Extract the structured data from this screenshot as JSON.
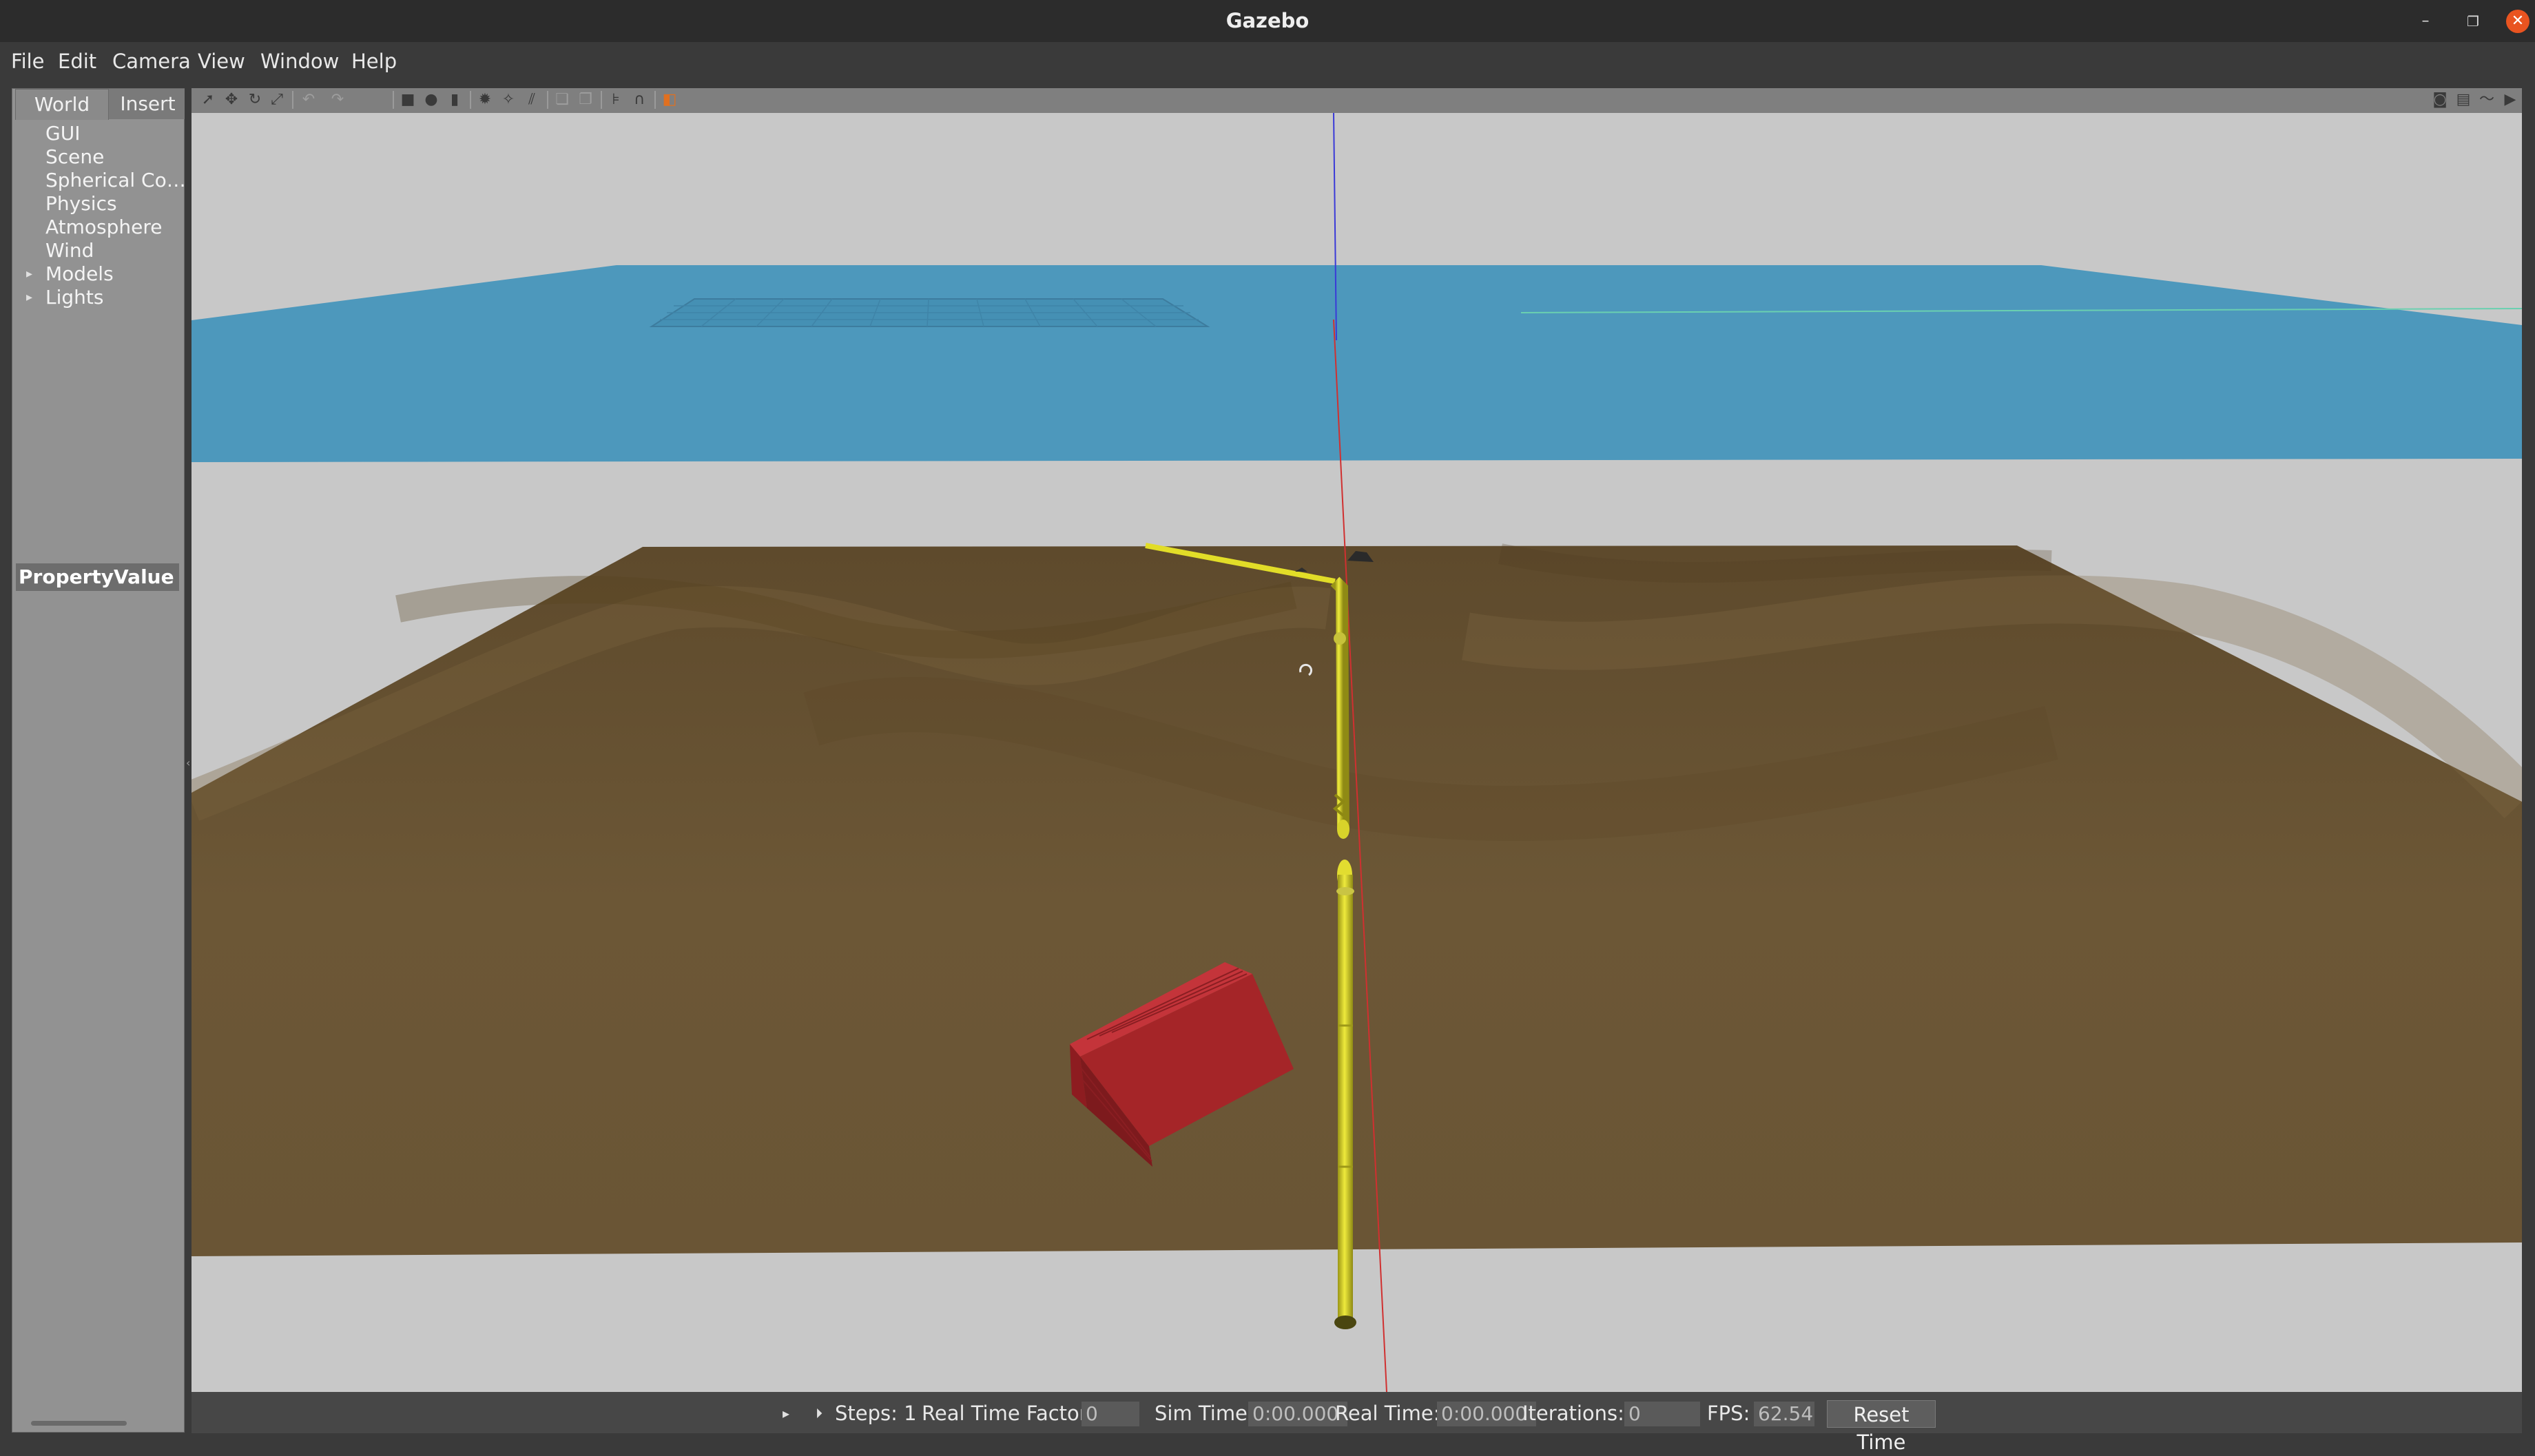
{
  "window": {
    "title": "Gazebo",
    "min_glyph": "–",
    "max_glyph": "❐",
    "close_glyph": "✕"
  },
  "menu": [
    "File",
    "Edit",
    "Camera",
    "View",
    "Window",
    "Help"
  ],
  "left_panel": {
    "tabs": {
      "world": "World",
      "insert": "Insert"
    },
    "tree": [
      "GUI",
      "Scene",
      "Spherical Co…",
      "Physics",
      "Atmosphere",
      "Wind",
      "Models",
      "Lights"
    ],
    "expandable": [
      "Models",
      "Lights"
    ],
    "property_header": "PropertyValue"
  },
  "toolbar": {
    "tools": [
      "select-mode-icon",
      "translate-mode-icon",
      "rotate-mode-icon",
      "scale-mode-icon",
      "undo-icon",
      "redo-icon",
      "box-shape-icon",
      "sphere-shape-icon",
      "cylinder-shape-icon",
      "point-light-icon",
      "spot-light-icon",
      "directional-light-icon",
      "copy-icon",
      "paste-icon",
      "align-icon",
      "snap-icon",
      "view-angle-icon",
      "screenshot-icon",
      "log-icon",
      "plot-icon",
      "video-icon"
    ]
  },
  "status": {
    "steps_label": "Steps: 1",
    "real_time_factor_label": "Real Time Factor:",
    "real_time_factor": "0",
    "sim_time_label": "Sim Time:",
    "sim_time": "0:00.000",
    "real_time_label": "Real Time:",
    "real_time": "0:00.000",
    "iterations_label": "Iterations:",
    "iterations": "0",
    "fps_label": "FPS:",
    "fps": "62.54",
    "reset_label": "Reset Time"
  },
  "colors": {
    "water": "#4d98bc",
    "seabed": "#6a5535",
    "pipeline": "#d8d32a",
    "container": "#b8262a",
    "accent": "#e95420"
  }
}
